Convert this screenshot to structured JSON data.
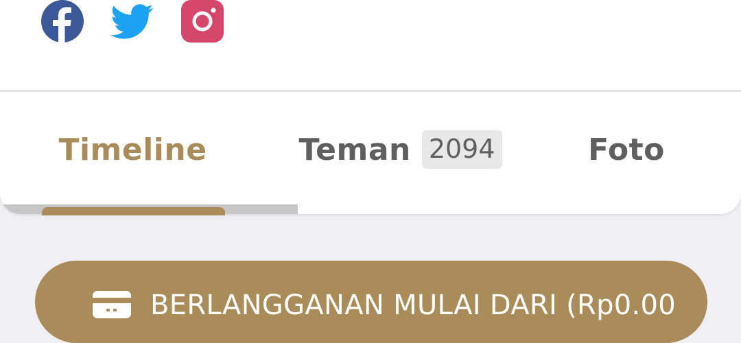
{
  "social": [
    {
      "name": "facebook",
      "icon": "facebook-icon",
      "color": "#3b5998"
    },
    {
      "name": "twitter",
      "icon": "twitter-icon",
      "color": "#1da1f2"
    },
    {
      "name": "instagram",
      "icon": "instagram-icon",
      "color": "#d6466b"
    }
  ],
  "tabs": [
    {
      "label": "Timeline",
      "active": true
    },
    {
      "label": "Teman",
      "badge": "2094",
      "active": false
    },
    {
      "label": "Foto",
      "active": false
    }
  ],
  "subscribe": {
    "icon": "card-icon",
    "label": "BERLANGGANAN MULAI DARI (Rp0.00"
  },
  "colors": {
    "accent": "#a98c5a",
    "background": "#efeff4",
    "tab_inactive": "#5f5f5f"
  }
}
